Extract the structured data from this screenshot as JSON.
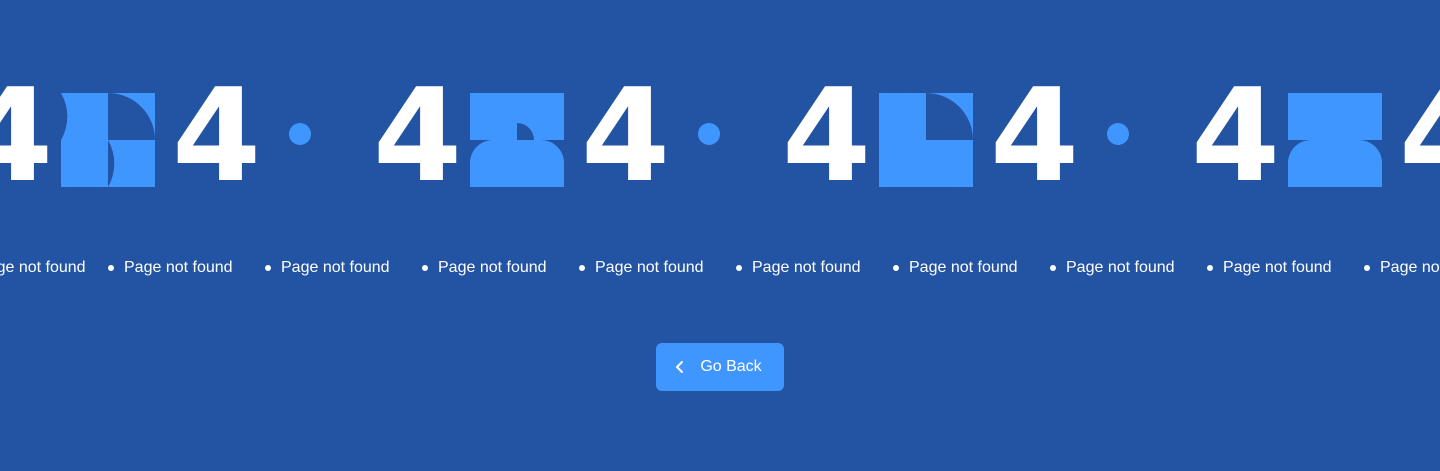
{
  "hero": {
    "digit_left": "4",
    "digit_right": "4",
    "repeat_count": 4
  },
  "tagline": {
    "text": "Page not found",
    "repeat_count": 10
  },
  "actions": {
    "go_back_label": "Go Back",
    "go_back_icon": "chevron-left-icon"
  },
  "colors": {
    "background": "#2354a4",
    "accent": "#4096ff",
    "text": "#ffffff"
  }
}
